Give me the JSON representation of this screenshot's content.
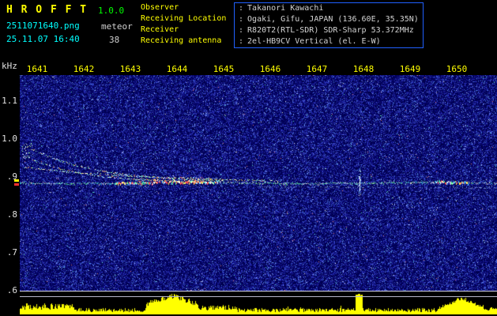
{
  "header": {
    "app_name": "H R O F F T",
    "version": "1.0.0",
    "filename": "2511071640.png",
    "mode": "meteor",
    "datetime": "25.11.07 16:40",
    "count": "38"
  },
  "info": {
    "colon": ":",
    "rows": [
      {
        "label": "Observer",
        "value": "Takanori Kawachi"
      },
      {
        "label": "Receiving Location",
        "value": "Ogaki, Gifu, JAPAN (136.60E, 35.35N)"
      },
      {
        "label": "Receiver",
        "value": "R820T2(RTL-SDR) SDR-Sharp 53.372MHz"
      },
      {
        "label": "Receiving antenna",
        "value": "2el-HB9CV Vertical (el. E-W)"
      }
    ]
  },
  "plot": {
    "freq_unit": "kHz",
    "freq_ticks": [
      "1.1",
      "1.0",
      ".9",
      ".8",
      ".7",
      ".6"
    ],
    "time_ticks": [
      "1641",
      "1642",
      "1643",
      "1644",
      "1645",
      "1646",
      "1647",
      "1648",
      "1649",
      "1650"
    ],
    "carrier_freq_khz": 0.9
  },
  "colors": {
    "background": "#000000",
    "noise_base": "#000055",
    "label_yellow": "#ffff00",
    "value_cyan": "#00ffff",
    "version_green": "#00ff00",
    "text_gray": "#d0d0d0",
    "info_border": "#2060ff",
    "level_yellow": "#ffff00",
    "ref_line_upper": "#d8d8e8",
    "ref_line_lower": "#b8b8cc",
    "marker_yellow": "#ffff00",
    "marker_red": "#ff3030"
  }
}
